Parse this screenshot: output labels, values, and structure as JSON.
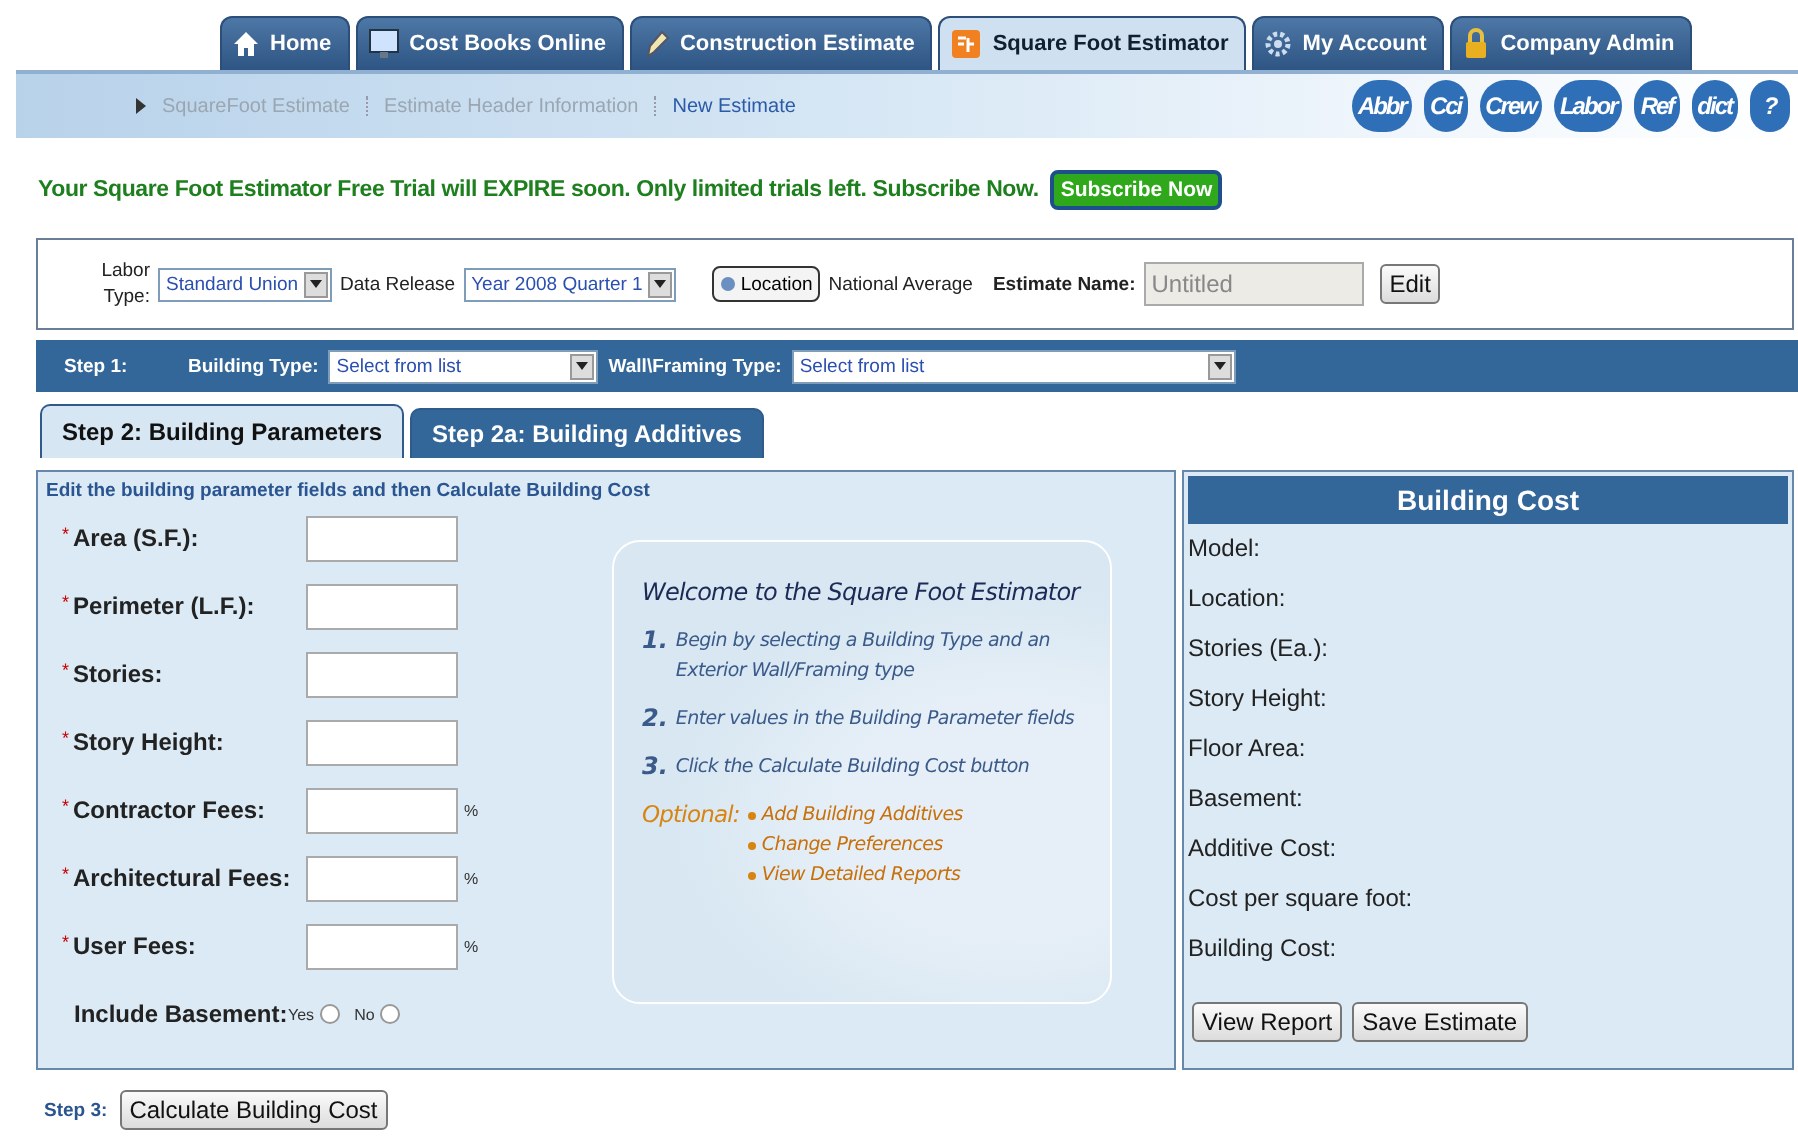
{
  "nav_tabs": [
    {
      "label": "Home",
      "selected": false
    },
    {
      "label": "Cost Books Online",
      "selected": false
    },
    {
      "label": "Construction Estimate",
      "selected": false
    },
    {
      "label": "Square Foot Estimator",
      "selected": true
    },
    {
      "label": "My Account",
      "selected": false
    },
    {
      "label": "Company Admin",
      "selected": false
    }
  ],
  "breadcrumb": [
    {
      "label": "SquareFoot Estimate",
      "selected": false
    },
    {
      "label": "Estimate Header Information",
      "selected": false
    },
    {
      "label": "New Estimate",
      "selected": true
    }
  ],
  "tool_icons": [
    "Abbr",
    "Cci",
    "Crew",
    "Labor",
    "Ref",
    "dict",
    "?"
  ],
  "trial_message": "Your Square Foot Estimator Free Trial will EXPIRE soon. Only limited trials left. Subscribe Now.",
  "subscribe_button": "Subscribe Now",
  "header": {
    "labor_type_label": "Labor Type:",
    "labor_type": "Standard Union",
    "data_release_label": "Data Release",
    "data_release": "Year 2008 Quarter 1",
    "location_button": "Location",
    "location": "National Average",
    "estimate_name_label": "Estimate Name:",
    "estimate_name": "Untitled",
    "edit_button": "Edit"
  },
  "step1": {
    "label": "Step 1:",
    "building_type_label": "Building Type:",
    "building_type": "Select from list",
    "wall_type_label": "Wall\\Framing Type:",
    "wall_type": "Select from list"
  },
  "step_tabs": [
    {
      "label": "Step 2: Building Parameters",
      "selected": true
    },
    {
      "label": "Step 2a: Building Additives",
      "selected": false
    }
  ],
  "parameters": {
    "instruction": "Edit the building parameter fields and then Calculate Building Cost",
    "fields": [
      {
        "label": "Area (S.F.):",
        "required_mark": "*"
      },
      {
        "label": "Perimeter (L.F.):",
        "required_mark": "*"
      },
      {
        "label": "Stories:",
        "required_mark": "*"
      },
      {
        "label": "Story Height:",
        "required_mark": "*"
      },
      {
        "label": "Contractor Fees:",
        "required_mark": "*",
        "unit": "%"
      },
      {
        "label": "Architectural Fees:",
        "required_mark": "*",
        "unit": "%"
      },
      {
        "label": "User Fees:",
        "required_mark": "*",
        "unit": "%"
      }
    ],
    "basement": {
      "label": "Include Basement:",
      "options": [
        {
          "label": "Yes",
          "selected": false
        },
        {
          "label": "No",
          "selected": false
        }
      ]
    }
  },
  "welcome": {
    "title": "Welcome to the Square Foot Estimator",
    "steps": [
      {
        "number": "1.",
        "text": "Begin by selecting a Building Type and an Exterior Wall/Framing type"
      },
      {
        "number": "2.",
        "text": "Enter values in the Building Parameter fields"
      },
      {
        "number": "3.",
        "text": "Click the Calculate Building Cost button"
      }
    ],
    "optional_label": "Optional:",
    "optional_links": [
      "Add Building Additives",
      "Change Preferences",
      "View Detailed Reports"
    ]
  },
  "building_cost": {
    "title": "Building Cost",
    "rows": [
      "Model:",
      "Location:",
      "Stories (Ea.):",
      "Story Height:",
      "Floor Area:",
      "Basement:",
      "Additive Cost:",
      "Cost per square foot:",
      "Building Cost:"
    ],
    "buttons": [
      "View Report",
      "Save Estimate"
    ]
  },
  "step3": {
    "label": "Step 3:",
    "button": "Calculate Building Cost"
  }
}
